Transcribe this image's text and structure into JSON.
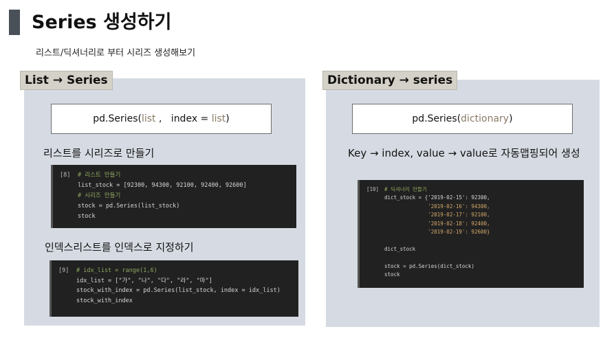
{
  "header": {
    "title": "Series 생성하기",
    "subtitle": "리스트/딕셔너리로 부터 시리즈 생성해보기"
  },
  "left": {
    "label": "List → Series",
    "formula": {
      "fn": "pd.Series(",
      "arg1": "list",
      "sep": " ,   index = ",
      "arg2": "list",
      "close": ")"
    },
    "caption1": "리스트를 시리즈로 만들기",
    "code1": {
      "prompt": "[8]",
      "lines": [
        "# 리스트 만들기",
        "list_stock = [92300, 94300, 92100, 92400, 92600]",
        "# 시리즈 만들기",
        "stock = pd.Series(list_stock)",
        "stock"
      ]
    },
    "caption2": "인덱스리스트를 인덱스로 지정하기",
    "code2": {
      "prompt": "[9]",
      "lines": [
        "# idx_list = range(1,6)",
        "idx_list = [\"가\", \"나\", \"다\", \"라\", \"마\"]",
        "stock_with_index = pd.Series(list_stock, index = idx_list)",
        "stock_with_index"
      ]
    }
  },
  "right": {
    "label": "Dictionary → series",
    "formula": {
      "fn": "pd.Series(",
      "arg1": "dictionary",
      "close": ")"
    },
    "caption": "Key → index, value → value로 자동맵핑되어 생성",
    "code": {
      "prompt": "[10]",
      "lines": [
        "# 딕셔너리 만들기",
        "dict_stock = {'2019-02-15': 92300,",
        "              '2019-02-16': 94300,",
        "              '2019-02-17': 92100,",
        "              '2019-02-18': 92400,",
        "              '2019-02-19': 92600}",
        "",
        "dict_stock",
        "",
        "stock = pd.Series(dict_stock)",
        "stock"
      ]
    }
  }
}
